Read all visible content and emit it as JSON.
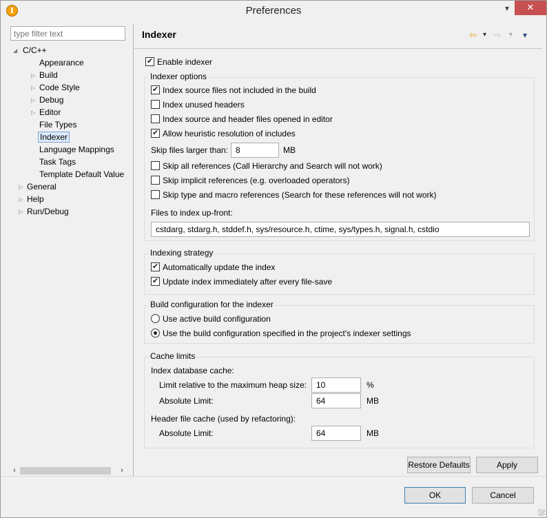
{
  "window": {
    "title": "Preferences",
    "help_glyph": "▾",
    "close_glyph": "✕",
    "app_icon_glyph": "I"
  },
  "filter": {
    "placeholder": "type filter text"
  },
  "tree": {
    "items": [
      {
        "label": "C/C++",
        "expanded": true
      },
      {
        "label": "Appearance"
      },
      {
        "label": "Build"
      },
      {
        "label": "Code Style"
      },
      {
        "label": "Debug"
      },
      {
        "label": "Editor"
      },
      {
        "label": "File Types"
      },
      {
        "label": "Indexer",
        "selected": true
      },
      {
        "label": "Language Mappings"
      },
      {
        "label": "Task Tags"
      },
      {
        "label": "Template Default Value"
      },
      {
        "label": "General"
      },
      {
        "label": "Help"
      },
      {
        "label": "Run/Debug"
      }
    ]
  },
  "page": {
    "title": "Indexer",
    "enable_indexer": "Enable indexer",
    "indexer_options": {
      "title": "Indexer options",
      "opt1": "Index source files not included in the build",
      "opt2": "Index unused headers",
      "opt3": "Index source and header files opened in editor",
      "opt4": "Allow heuristic resolution of includes",
      "skip_label": "Skip files larger than:",
      "skip_value": "8",
      "skip_unit": "MB",
      "skip_all": "Skip all references (Call Hierarchy and Search will not work)",
      "skip_implicit": "Skip implicit references (e.g. overloaded operators)",
      "skip_type": "Skip type and macro references (Search for these references will not work)",
      "files_label": "Files to index up-front:",
      "files_value": "cstdarg, stdarg.h, stddef.h, sys/resource.h, ctime, sys/types.h, signal.h, cstdio"
    },
    "strategy": {
      "title": "Indexing strategy",
      "auto_update": "Automatically update the index",
      "update_immediately": "Update index immediately after every file-save"
    },
    "build_config": {
      "title": "Build configuration for the indexer",
      "active": "Use active build configuration",
      "specified": "Use the build configuration specified in the project's indexer settings"
    },
    "cache": {
      "title": "Cache limits",
      "db_label": "Index database cache:",
      "relative_label": "Limit relative to the maximum heap size:",
      "relative_value": "10",
      "relative_unit": "%",
      "absolute_label": "Absolute Limit:",
      "absolute_value": "64",
      "absolute_unit": "MB",
      "header_label": "Header file cache (used by refactoring):",
      "header_abs_label": "Absolute Limit:",
      "header_abs_value": "64",
      "header_abs_unit": "MB"
    },
    "restore_defaults": "Restore Defaults",
    "apply": "Apply"
  },
  "footer": {
    "ok": "OK",
    "cancel": "Cancel"
  },
  "nav_icons": {
    "back": "⇦",
    "forward": "⇨",
    "dropdown": "▾",
    "menu": "▾"
  }
}
